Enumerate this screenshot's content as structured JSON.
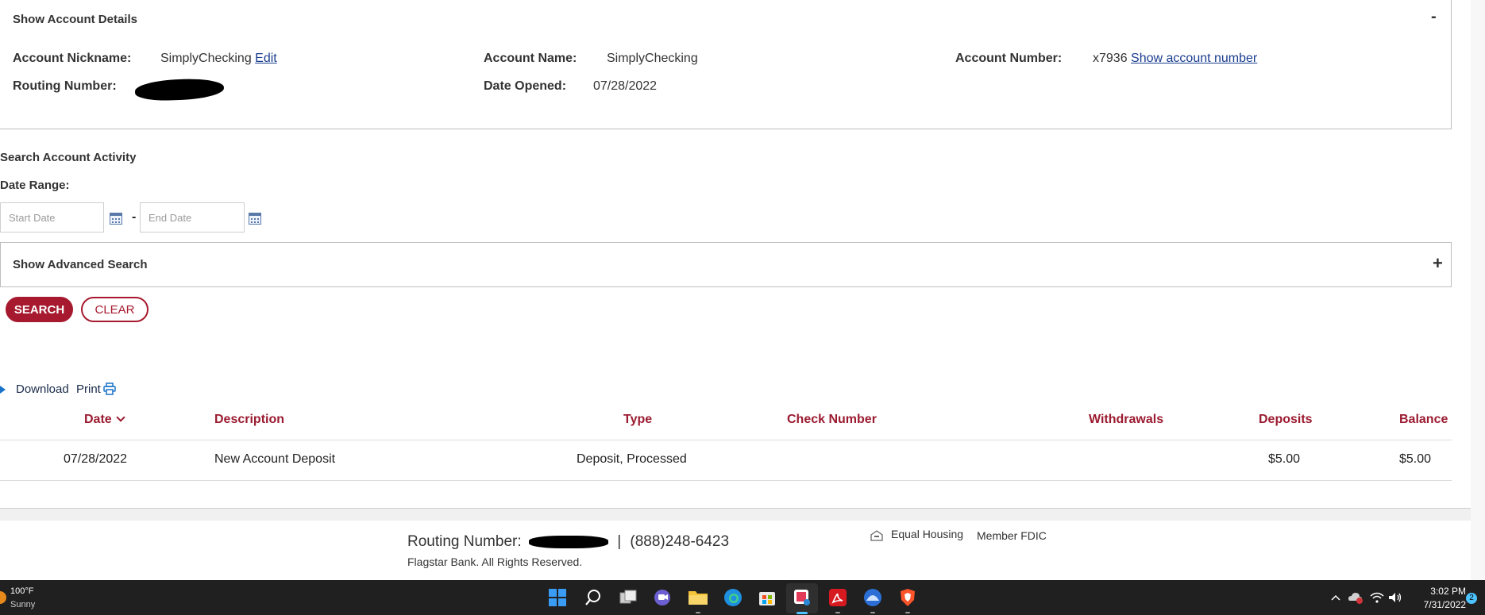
{
  "account_details": {
    "header": "Show Account Details",
    "toggle_symbol": "-",
    "nickname_label": "Account Nickname:",
    "nickname_value": "SimplyChecking",
    "edit_link": "Edit",
    "name_label": "Account Name:",
    "name_value": "SimplyChecking",
    "number_label": "Account Number:",
    "number_value": "x7936",
    "show_number_link": "Show account number",
    "routing_label": "Routing Number:",
    "date_opened_label": "Date Opened:",
    "date_opened_value": "07/28/2022"
  },
  "search": {
    "title": "Search Account Activity",
    "date_range_label": "Date Range:",
    "start_placeholder": "Start Date",
    "end_placeholder": "End Date",
    "range_separator": "-",
    "advanced_label": "Show Advanced Search",
    "advanced_toggle": "+",
    "search_button": "SEARCH",
    "clear_button": "CLEAR"
  },
  "actions": {
    "download_label": "Download",
    "print_label": "Print"
  },
  "table": {
    "columns": {
      "date": "Date",
      "description": "Description",
      "type": "Type",
      "check_number": "Check Number",
      "withdrawals": "Withdrawals",
      "deposits": "Deposits",
      "balance": "Balance"
    },
    "rows": [
      {
        "date": "07/28/2022",
        "description": "New Account Deposit",
        "type": "Deposit, Processed",
        "check_number": "",
        "withdrawals": "",
        "deposits": "$5.00",
        "balance": "$5.00"
      }
    ]
  },
  "footer": {
    "routing_label": "Routing Number:",
    "separator": "|",
    "phone": "(888)248-6423",
    "copyright": "Flagstar Bank. All Rights Reserved.",
    "equal_housing": "Equal Housing",
    "member_fdic": "Member FDIC"
  },
  "taskbar": {
    "weather_temp": "100°F",
    "weather_desc": "Sunny",
    "time": "3:02 PM",
    "date": "7/31/2022",
    "notification_count": "2"
  },
  "colors": {
    "brand_red": "#a6192e",
    "header_red": "#9b1b30",
    "link_blue": "#1a3d8f",
    "taskbar_bg": "#202020"
  }
}
